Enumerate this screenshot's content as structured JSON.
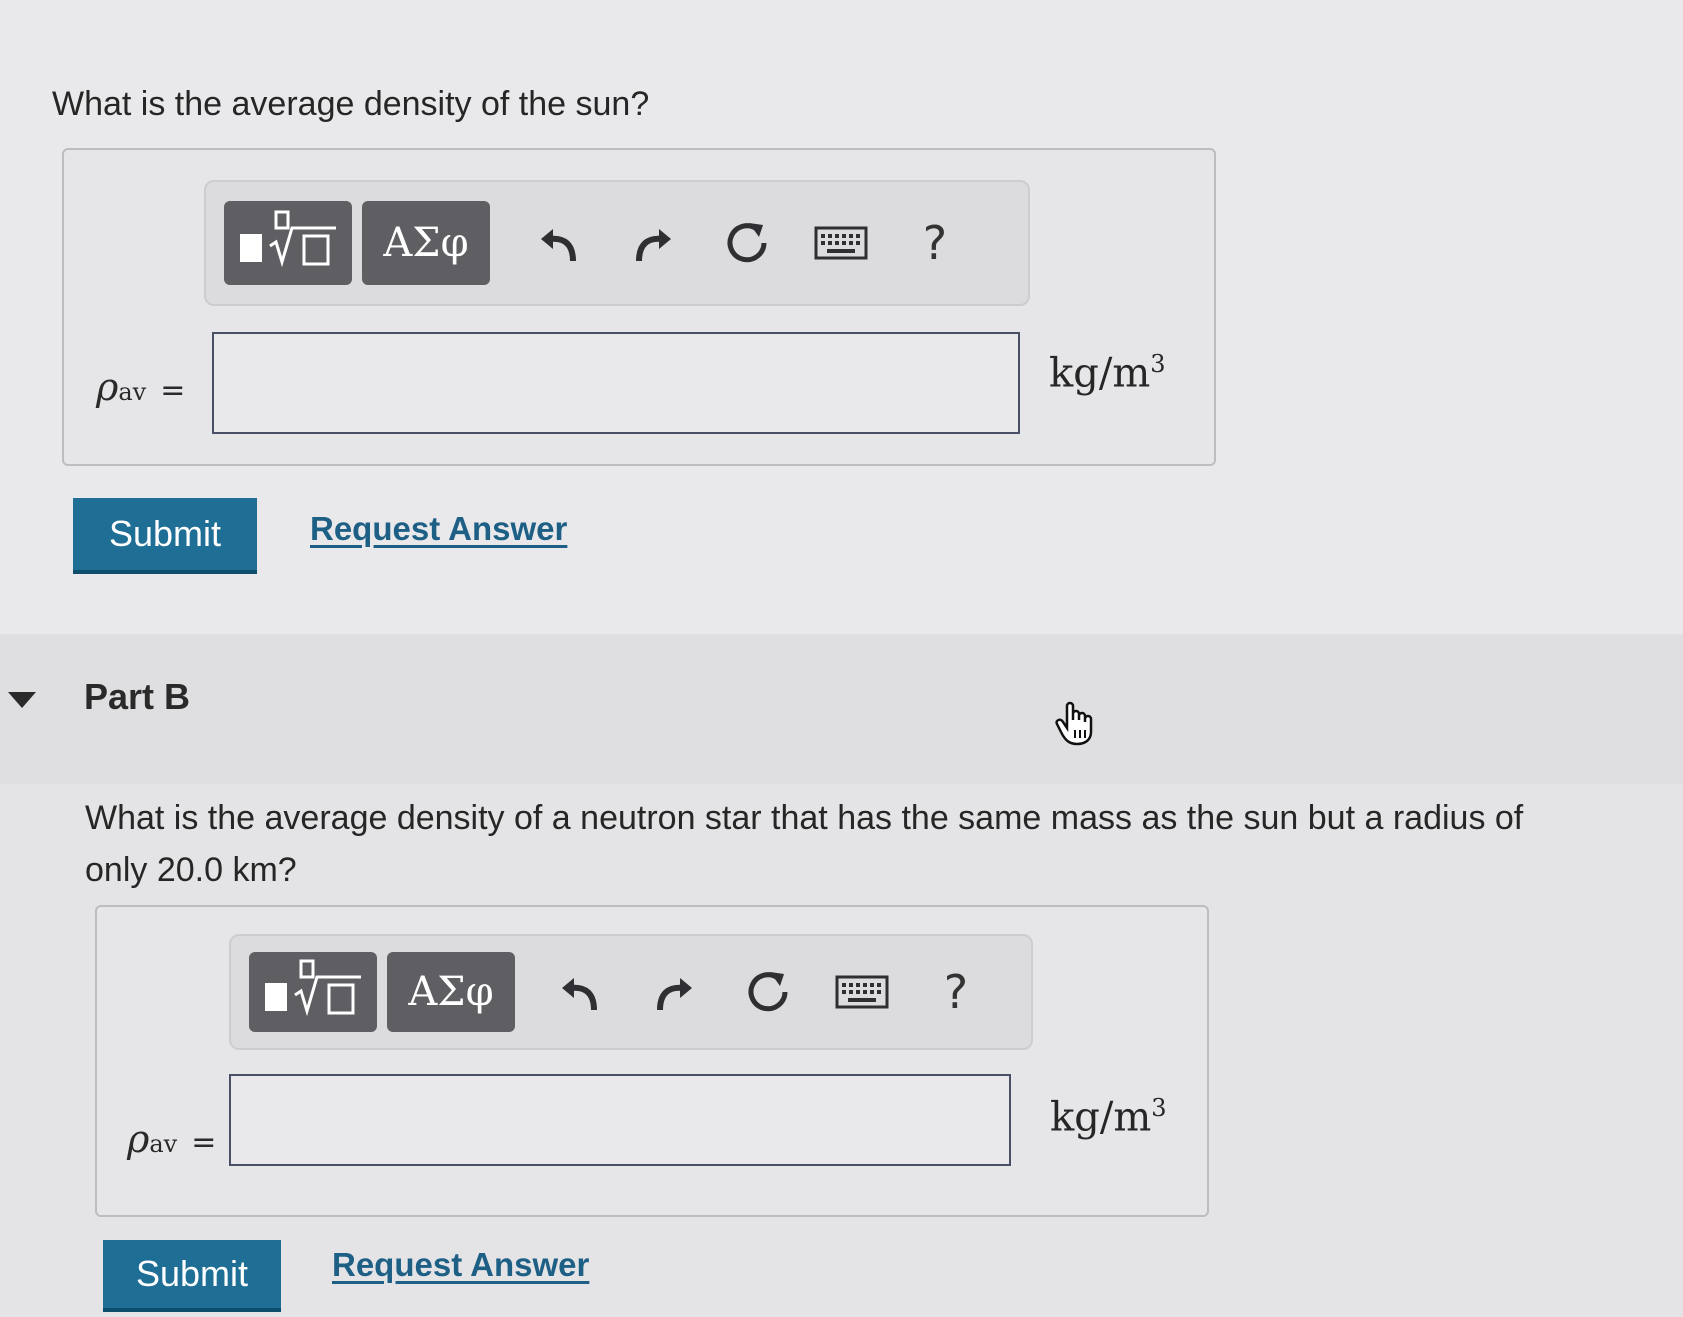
{
  "part_a": {
    "question": "What is the average density of the sun?",
    "toolbar": {
      "greek_label": "ΑΣφ",
      "help_label": "?"
    },
    "variable": {
      "symbol": "ρ",
      "subscript": "av",
      "equals": "="
    },
    "input": {
      "value": "",
      "placeholder": ""
    },
    "unit": {
      "base": "kg/m",
      "exponent": "3"
    },
    "submit_label": "Submit",
    "request_label": "Request Answer"
  },
  "part_b": {
    "header": "Part B",
    "question": "What is the average density of a neutron star that has the same mass as the sun but a radius of only 20.0 km?",
    "toolbar": {
      "greek_label": "ΑΣφ",
      "help_label": "?"
    },
    "variable": {
      "symbol": "ρ",
      "subscript": "av",
      "equals": "="
    },
    "input": {
      "value": "",
      "placeholder": ""
    },
    "unit": {
      "base": "kg/m",
      "exponent": "3"
    },
    "submit_label": "Submit",
    "request_label": "Request Answer"
  },
  "icons": [
    "templates-icon",
    "undo-icon",
    "redo-icon",
    "reset-icon",
    "keyboard-icon",
    "help-icon",
    "collapse-caret-icon",
    "hand-cursor-icon"
  ],
  "colors": {
    "submit_bg": "#1f6e95",
    "link": "#1e5f86",
    "toolbar_btn": "#5f5f63"
  }
}
